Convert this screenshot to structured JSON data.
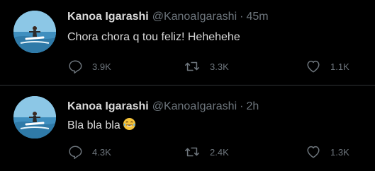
{
  "tweets": [
    {
      "name": "Kanoa Igarashi",
      "handle": "@KanoaIgarashi",
      "separator": "·",
      "time": "45m",
      "text": "Chora chora q tou feliz! Hehehehe",
      "emoji": "",
      "replies": "3.9K",
      "retweets": "3.3K",
      "likes": "1.1K"
    },
    {
      "name": "Kanoa Igarashi",
      "handle": "@KanoaIgarashi",
      "separator": "·",
      "time": "2h",
      "text": "Bla bla bla",
      "emoji": "face-with-tears-of-joy-icon",
      "replies": "4.3K",
      "retweets": "2.4K",
      "likes": "1.3K"
    }
  ],
  "colors": {
    "background": "#000000",
    "text": "#d9d9d9",
    "muted": "#6e767d",
    "divider": "#2f3336"
  }
}
